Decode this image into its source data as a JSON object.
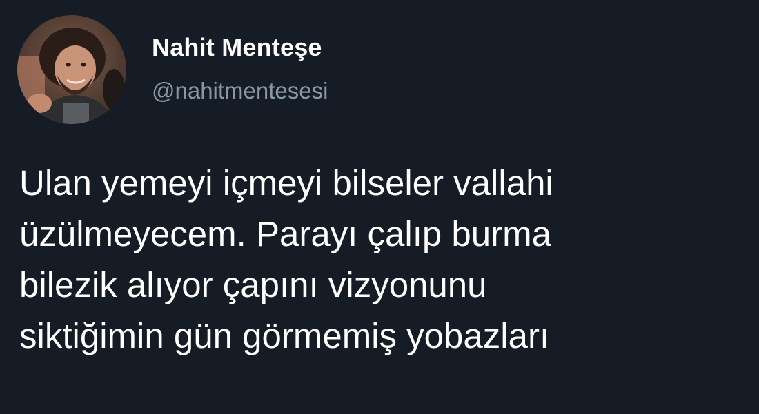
{
  "author": {
    "display_name": "Nahit Menteşe",
    "handle": "@nahitmentesesi",
    "avatar_icon": "profile-photo"
  },
  "tweet": {
    "lines": [
      "Ulan yemeyi içmeyi bilseler vallahi",
      "üzülmeyecem. Parayı çalıp burma",
      "bilezik alıyor çapını vizyonunu",
      "siktiğimin gün görmemiş yobazları"
    ]
  },
  "colors": {
    "background": "#151c26",
    "text": "#ffffff",
    "handle": "#8899a6"
  }
}
